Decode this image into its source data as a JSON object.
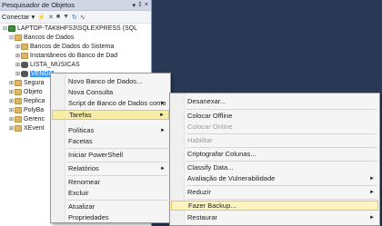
{
  "explorer": {
    "title": "Pesquisador de Objetos",
    "title_buttons": [
      "▾",
      "‡",
      "×"
    ],
    "toolbar": {
      "connect_label": "Conectar ▾"
    },
    "tree": [
      {
        "label": "LAPTOP-TAK8HFS3\\SQLEXPRESS (SQL",
        "icon": "server"
      },
      {
        "label": "Bancos de Dados",
        "icon": "folder"
      },
      {
        "label": "Bancos de Dados do Sistema",
        "icon": "folder"
      },
      {
        "label": "Instantâneos do Banco de Dad",
        "icon": "folder"
      },
      {
        "label": "LISTA_MÚSICAS",
        "icon": "db"
      },
      {
        "label": "VENDA",
        "icon": "db"
      },
      {
        "label": "Segura",
        "icon": "folder"
      },
      {
        "label": "Objeto",
        "icon": "folder"
      },
      {
        "label": "Replica",
        "icon": "folder"
      },
      {
        "label": "PolyBa",
        "icon": "folder"
      },
      {
        "label": "Gerenc",
        "icon": "folder"
      },
      {
        "label": "XEvent",
        "icon": "folder"
      }
    ]
  },
  "context_menu": {
    "items": [
      "Novo Banco de Dados...",
      "Nova Consulta",
      "Script de Banco de Dados como",
      "Tarefas",
      "Políticas",
      "Facetas",
      "Iniciar PowerShell",
      "Relatórios",
      "Renomear",
      "Excluir",
      "Atualizar",
      "Propriedades"
    ]
  },
  "tasks_menu": {
    "items": [
      "Desanexar...",
      "Colocar Offline",
      "Colocar Online",
      "Habilitar",
      "Criptografar Colunas...",
      "Classify Data...",
      "Avaliação de Vulnerabilidade",
      "Reduzir",
      "Fazer Backup...",
      "Restaurar"
    ]
  }
}
